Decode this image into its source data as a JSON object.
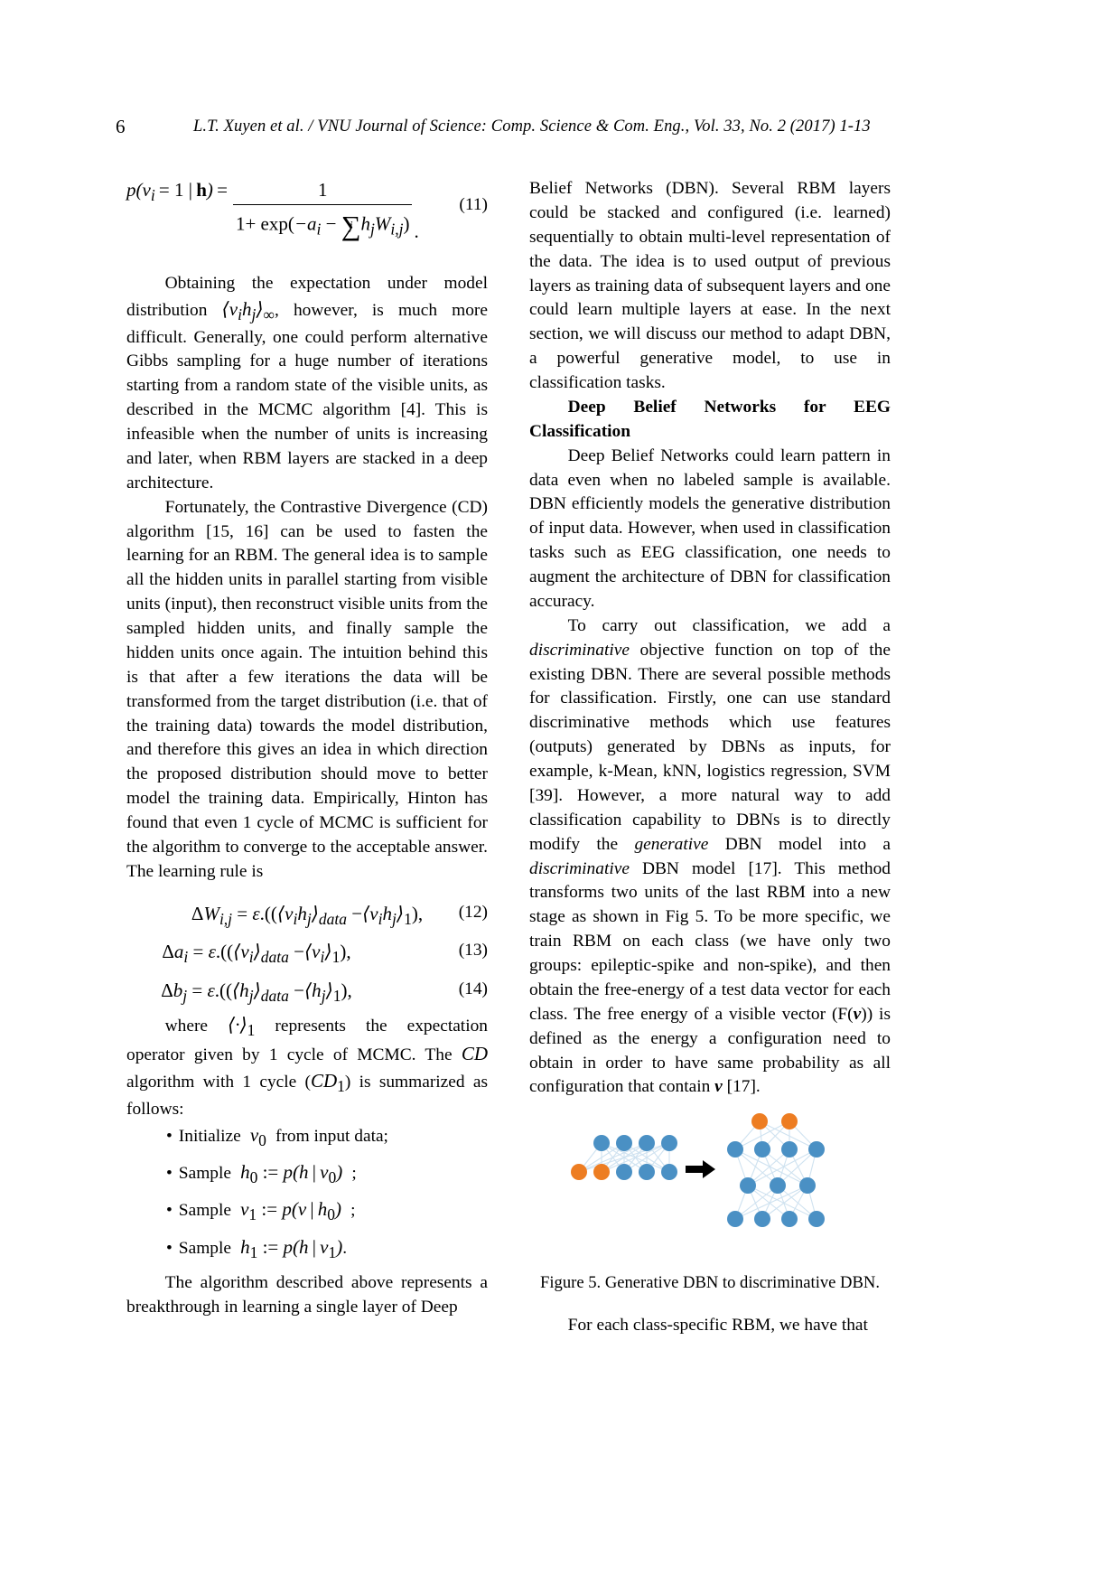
{
  "header": {
    "folio": "6",
    "running_title": "L.T. Xuyen et al. / VNU Journal of Science: Comp. Science & Com. Eng., Vol. 33, No. 2 (2017) 1-13"
  },
  "left_column": {
    "equation_11_number": "(11)",
    "paragraph_1": "Obtaining the expectation under model distribution",
    "paragraph_1b": ", however, is much more difficult. Generally, one could perform alternative Gibbs sampling for a huge number of iterations starting from a random state of the visible units, as described in the MCMC algorithm [4]. This is infeasible when the number of units is increasing and later, when RBM layers are stacked in a deep architecture.",
    "paragraph_2": "Fortunately, the Contrastive Divergence (CD) algorithm [15, 16] can be used to fasten the learning for an RBM. The general idea is to sample all the hidden units in parallel starting from visible units (input), then reconstruct visible units from the sampled hidden units, and finally sample the hidden units once again. The intuition behind this is that after a few iterations the data will be transformed from the target distribution (i.e. that of the training data) towards the model distribution, and therefore this gives an idea in which direction the proposed distribution should move to better model the training data. Empirically, Hinton has found that even 1 cycle of MCMC is sufficient for the algorithm to converge to the acceptable answer. The learning rule is",
    "equation_12_number": "(12)",
    "equation_13_number": "(13)",
    "equation_14_number": "(14)",
    "paragraph_3_a": "where",
    "paragraph_3_b": "represents the expectation operator given by 1 cycle of MCMC. The",
    "paragraph_3_c": "algorithm with 1 cycle (",
    "paragraph_3_d": ") is summarized as follows:",
    "bullets": [
      {
        "bullet": "•",
        "label": "Initialize",
        "tail": "from input data;"
      },
      {
        "bullet": "•",
        "label": "Sample",
        "tail": ";"
      },
      {
        "bullet": "•",
        "label": "Sample",
        "tail": ";"
      },
      {
        "bullet": "•",
        "label": "Sample",
        "tail": "."
      }
    ],
    "paragraph_4": "The algorithm described above represents a breakthrough in learning a single layer of Deep"
  },
  "right_column": {
    "paragraph_1": "Belief Networks (DBN). Several RBM layers could be stacked and configured (i.e. learned) sequentially to obtain multi-level representation of the data. The idea is to used output of previous layers as training data of subsequent layers and one could learn multiple layers at ease. In the next section, we will discuss our method to adapt DBN, a powerful generative model, to use in classification tasks.",
    "section_heading": "Deep Belief Networks for EEG Classification",
    "paragraph_2": "Deep Belief Networks could learn pattern in data even when no labeled sample is available. DBN efficiently models the generative distribution of input data. However, when used in classification tasks such as EEG classification, one needs to augment the architecture of DBN for classification accuracy.",
    "paragraph_3_a": "To carry out classification, we add a ",
    "paragraph_3_ital1": "discriminative",
    "paragraph_3_b": " objective function on top of the existing DBN. There are several possible methods for classification. Firstly, one can use standard discriminative methods which use features (outputs) generated by DBNs as inputs, for example, k-Mean, kNN, logistics regression, SVM [39]. However, a more natural way to add classification capability to DBNs is to directly modify the ",
    "paragraph_3_ital2": "generative",
    "paragraph_3_c": " DBN model into a ",
    "paragraph_3_ital3": "discriminative",
    "paragraph_3_d": " DBN model [17]. This method transforms two units of the last RBM into a new stage as shown in Fig 5. To be more specific, we train RBM on each class (we have only two groups: epileptic-spike and non-spike), and then obtain the free-energy of a test data vector for each class. The free energy of a visible vector (F(",
    "paragraph_3_vbold1": "v",
    "paragraph_3_e": ")) is defined as the energy a configuration need to obtain in order to have same probability as all configuration that contain ",
    "paragraph_3_vbold2": "v",
    "paragraph_3_f": " [17].",
    "figure_caption": "Figure  5. Generative DBN to discriminative DBN.",
    "paragraph_4": "For each class-specific RBM, we have that"
  },
  "figure": {
    "name": "generative-to-discriminative-dbn-diagram",
    "colors": {
      "node_blue": "#4a90c4",
      "node_orange": "#ed7d22",
      "edge": "#cfe2f0",
      "arrow": "#000000"
    },
    "left_network": {
      "top_layer_blue": 4,
      "bottom_layer_orange": 2,
      "bottom_layer_blue": 3
    },
    "right_network": {
      "layer_top_orange": 2,
      "layer_second_blue": 4,
      "layer_third_blue": 3,
      "layer_bottom_blue": 4
    }
  }
}
